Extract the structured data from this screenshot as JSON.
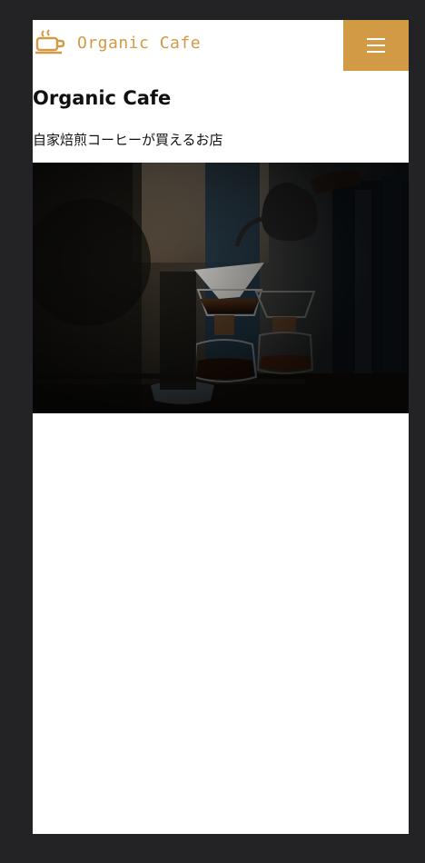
{
  "header": {
    "logo_text": "Organic Cafe",
    "logo_icon": "coffee-cup-icon",
    "menu_icon": "hamburger-menu-icon"
  },
  "main": {
    "title": "Organic Cafe",
    "subtitle": "自家焙煎コーヒーが買えるお店",
    "hero_image": "coffee-pour-over-photo"
  },
  "colors": {
    "accent": "#d39a46",
    "frame": "#232325",
    "background": "#ffffff",
    "text": "#111111"
  }
}
